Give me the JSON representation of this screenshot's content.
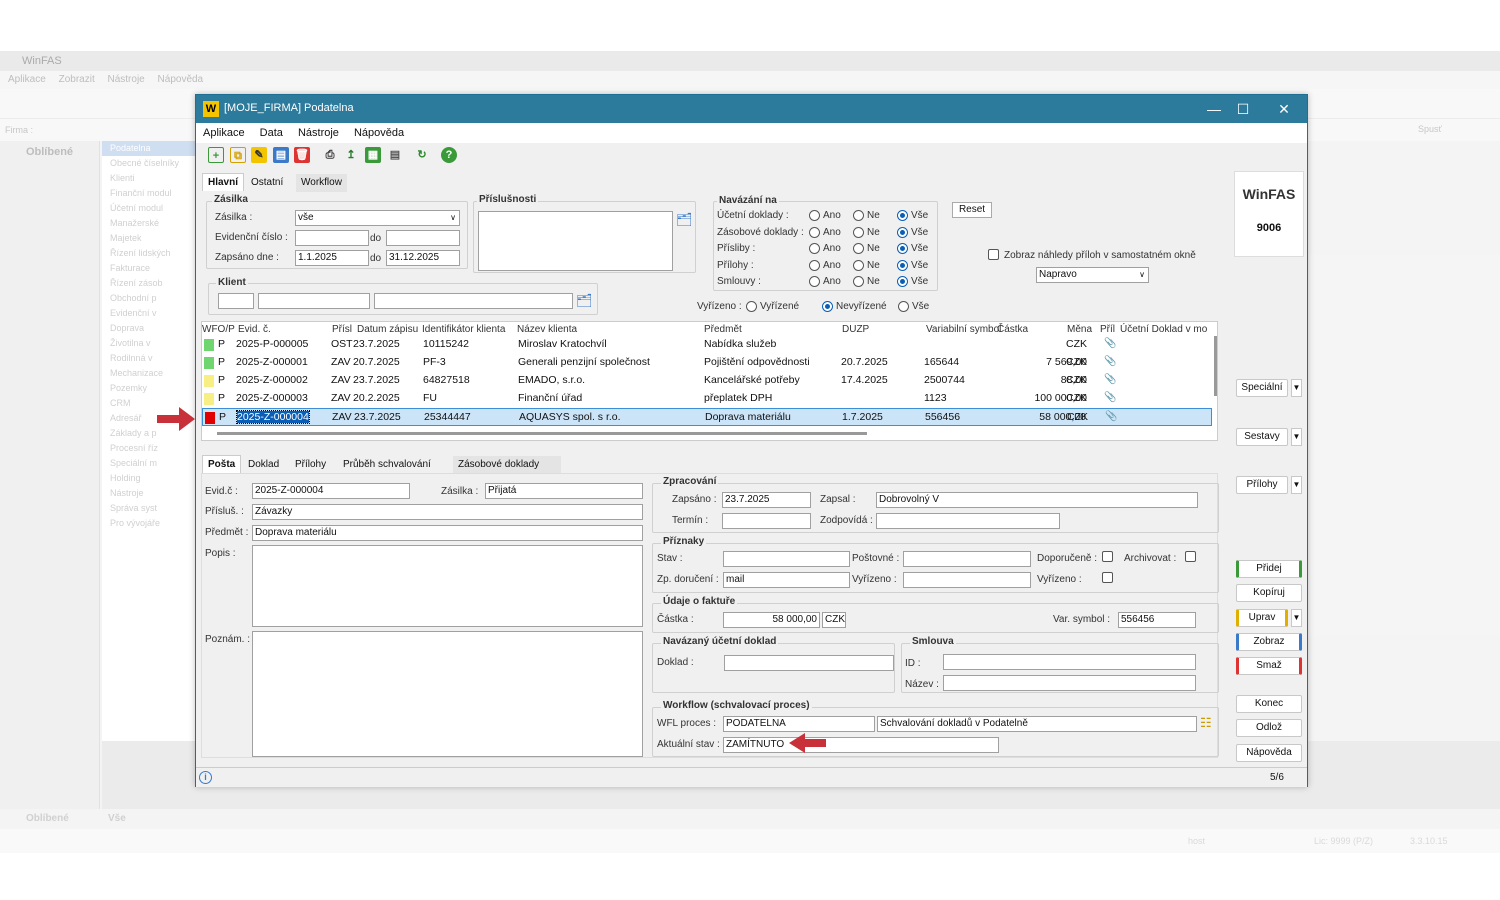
{
  "background_app": {
    "title": "WinFAS",
    "menu": [
      "Aplikace",
      "Zobrazit",
      "Nástroje",
      "Nápověda"
    ],
    "firma_label": "Firma :",
    "left_header": "Oblíbené",
    "left_footer": "Oblíbené",
    "footer_all": "Vše",
    "tree_items": [
      "Podatelna",
      "Obecné číselníky",
      "Klienti",
      "Finanční modul",
      "Účetní modul",
      "Manažerské",
      "Majetek",
      "Řízení lidských",
      "Fakturace",
      "Řízení zásob",
      "Obchodní p",
      "Evidenční v",
      "Doprava",
      "Životilna v",
      "Rodilnná v",
      "Mechanizace",
      "Pozemky",
      "CRM",
      "Adresář",
      "Základy a p",
      "Procesní říz",
      "Speciální m",
      "Holding",
      "Nástroje",
      "Správa syst",
      "Pro vývojáře"
    ],
    "spust": "Spusť",
    "status_host": "host",
    "status_lic": "Lic: 9999 (P/Z)",
    "status_version": "3.3.10.15"
  },
  "window": {
    "title": "[MOJE_FIRMA] Podatelna",
    "menu": [
      "Aplikace",
      "Data",
      "Nástroje",
      "Nápověda"
    ]
  },
  "top_tabs": [
    "Hlavní",
    "Ostatní",
    "Workflow"
  ],
  "filter": {
    "zasilka_group": "Zásilka",
    "zasilka_label": "Zásilka :",
    "zasilka_value": "vše",
    "evid_label": "Evidenční číslo :",
    "do1": "do",
    "zapsano_label": "Zapsáno dne :",
    "date_from": "1.1.2025",
    "do2": "do",
    "date_to": "31.12.2025",
    "prislusnosti": "Příslušnosti",
    "klient": "Klient",
    "navazani": "Navázání na",
    "nav_rows": [
      "Účetní doklady :",
      "Zásobové doklady :",
      "Přísliby :",
      "Přílohy :",
      "Smlouvy :"
    ],
    "ano": "Ano",
    "ne": "Ne",
    "vse": "Vše",
    "reset": "Reset",
    "zobraz_nahledy": "Zobraz náhledy příloh v samostatném okně",
    "napravo": "Napravo",
    "vyrizeno_label": "Vyřízeno :",
    "vyrizene": "Vyřízené",
    "nevyrizene": "Nevyřízené",
    "vse2": "Vše"
  },
  "grid": {
    "headers": [
      "WFO/P",
      "Evid. č.",
      "Přísl",
      "Datum zápisu",
      "Identifikátor klienta",
      "Název klienta",
      "Předmět",
      "DUZP",
      "Variabilní symbol",
      "Částka",
      "Měna",
      "Příl",
      "Účetní Doklad v mo"
    ],
    "rows": [
      {
        "color": "#6fd66f",
        "p": "P",
        "evid": "2025-P-000005",
        "prisl": "OST",
        "datum": "23.7.2025",
        "ident": "10115242",
        "nazev": "Miroslav Kratochvíl",
        "predmet": "Nabídka služeb",
        "duzp": "",
        "vs": "",
        "castka": "",
        "mena": "CZK"
      },
      {
        "color": "#6fd66f",
        "p": "P",
        "evid": "2025-Z-000001",
        "prisl": "ZAV",
        "datum": "20.7.2025",
        "ident": "PF-3",
        "nazev": "Generali penzijní společnost",
        "predmet": "Pojištění odpovědnosti",
        "duzp": "20.7.2025",
        "vs": "165644",
        "castka": "7 569,00",
        "mena": "CZK"
      },
      {
        "color": "#f7ee84",
        "p": "P",
        "evid": "2025-Z-000002",
        "prisl": "ZAV",
        "datum": "23.7.2025",
        "ident": "64827518",
        "nazev": "EMADO, s.r.o.",
        "predmet": "Kancelářské potřeby",
        "duzp": "17.4.2025",
        "vs": "2500744",
        "castka": "88,00",
        "mena": "CZK"
      },
      {
        "color": "#f7ee84",
        "p": "P",
        "evid": "2025-Z-000003",
        "prisl": "ZAV",
        "datum": "20.2.2025",
        "ident": "FU",
        "nazev": "Finanční úřad",
        "predmet": "přeplatek DPH",
        "duzp": "",
        "vs": "1123",
        "castka": "100 000,00",
        "mena": "CZK"
      },
      {
        "color": "#e00000",
        "p": "P",
        "evid": "2025-Z-000004",
        "prisl": "ZAV",
        "datum": "23.7.2025",
        "ident": "25344447",
        "nazev": "AQUASYS spol. s r.o.",
        "predmet": "Doprava materiálu",
        "duzp": "1.7.2025",
        "vs": "556456",
        "castka": "58 000,00",
        "mena": "CZK"
      }
    ]
  },
  "detail_tabs": [
    "Pošta",
    "Doklad",
    "Přílohy",
    "Průběh schvalování",
    "Zásobové doklady"
  ],
  "detail": {
    "evid_label": "Evid.č :",
    "evid": "2025-Z-000004",
    "zasilka_label": "Zásilka :",
    "zasilka": "Přijatá",
    "prislus_label": "Přísluš. :",
    "prislus": "Závazky",
    "predmet_label": "Předmět :",
    "predmet": "Doprava materiálu",
    "popis_label": "Popis :",
    "poznam_label": "Poznám. :",
    "zpracovani": "Zpracování",
    "zapsano_label": "Zapsáno :",
    "zapsano": "23.7.2025",
    "zapsal_label": "Zapsal :",
    "zapsal": "Dobrovolný V",
    "termin_label": "Termín :",
    "zodpovida_label": "Zodpovídá :",
    "priznaky": "Příznaky",
    "stav_label": "Stav :",
    "postovne_label": "Poštovné :",
    "doporuceno_label": "Doporučeně :",
    "archivovat_label": "Archivovat :",
    "zp_doruceni_label": "Zp. doručení :",
    "zp_doruceni": "mail",
    "vyrizeno_label": "Vyřízeno :",
    "vyrizeno2_label": "Vyřízeno :",
    "udaje": "Údaje o faktuře",
    "castka_label": "Částka :",
    "castka": "58 000,00",
    "mena": "CZK",
    "vs_label": "Var. symbol :",
    "vs": "556456",
    "navazany": "Navázaný účetní doklad",
    "doklad_label": "Doklad :",
    "smlouva": "Smlouva",
    "id_label": "ID :",
    "nazev_label": "Název :",
    "workflow": "Workflow (schvalovací proces)",
    "wfl_label": "WFL proces :",
    "wfl": "PODATELNA",
    "wfl_desc": "Schvalování dokladů v Podatelně",
    "aktualni_label": "Aktuální stav :",
    "aktualni": "ZAMÍTNUTO"
  },
  "side": {
    "brand": "WinFAS",
    "number": "9006",
    "specialni": "Speciální",
    "sestavy": "Sestavy",
    "prilohy": "Přílohy",
    "pridej": "Přidej",
    "kopiruj": "Kopíruj",
    "uprav": "Uprav",
    "zobraz": "Zobraz",
    "smaz": "Smaž",
    "konec": "Konec",
    "odloz": "Odlož",
    "napoveda": "Nápověda"
  },
  "status": {
    "page": "5/6"
  }
}
